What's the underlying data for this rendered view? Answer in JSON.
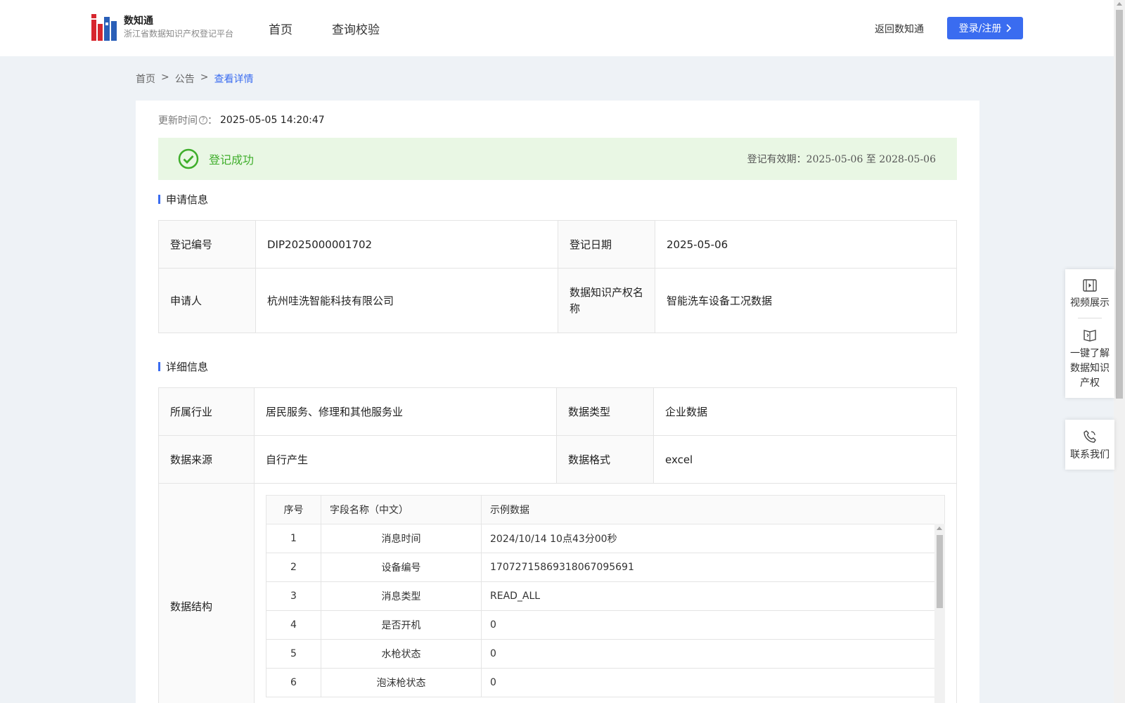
{
  "header": {
    "logo_title": "数知通",
    "logo_subtitle": "浙江省数据知识产权登记平台",
    "nav": [
      "首页",
      "查询校验"
    ],
    "back_link": "返回数知通",
    "login_button": "登录/注册"
  },
  "breadcrumb": [
    "首页",
    "公告",
    "查看详情"
  ],
  "breadcrumb_sep": ">",
  "update": {
    "label": "更新时间",
    "value": "2025-05-05 14:20:47"
  },
  "status": {
    "label": "登记成功",
    "validity_label": "登记有效期：",
    "validity_from": "2025-05-06",
    "validity_sep": "至",
    "validity_to": "2028-05-06"
  },
  "apply_section": {
    "title": "申请信息",
    "reg_no_label": "登记编号",
    "reg_no": "DIP2025000001702",
    "reg_date_label": "登记日期",
    "reg_date": "2025-05-06",
    "applicant_label": "申请人",
    "applicant": "杭州哇洗智能科技有限公司",
    "ip_name_label": "数据知识产权名称",
    "ip_name": "智能洗车设备工况数据"
  },
  "detail_section": {
    "title": "详细信息",
    "industry_label": "所属行业",
    "industry": "居民服务、修理和其他服务业",
    "data_type_label": "数据类型",
    "data_type": "企业数据",
    "source_label": "数据来源",
    "source": "自行产生",
    "format_label": "数据格式",
    "format": "excel",
    "structure_label": "数据结构"
  },
  "structure_table": {
    "headers": [
      "序号",
      "字段名称（中文）",
      "示例数据"
    ],
    "rows": [
      {
        "no": "1",
        "name": "消息时间",
        "sample": "2024/10/14 10点43分00秒"
      },
      {
        "no": "2",
        "name": "设备编号",
        "sample": "1707271586931806709569​1"
      },
      {
        "no": "3",
        "name": "消息类型",
        "sample": "READ_ALL"
      },
      {
        "no": "4",
        "name": "是否开机",
        "sample": "0"
      },
      {
        "no": "5",
        "name": "水枪状态",
        "sample": "0"
      },
      {
        "no": "6",
        "name": "泡沫枪状态",
        "sample": "0"
      }
    ]
  },
  "float_panel": {
    "video": "视频展示",
    "learn": [
      "一键了解",
      "数据知识",
      "产权"
    ],
    "contact": "联系我们"
  },
  "colors": {
    "accent": "#3a6cf0",
    "success": "#3fae2b",
    "success_bg": "#e9f7e4"
  }
}
